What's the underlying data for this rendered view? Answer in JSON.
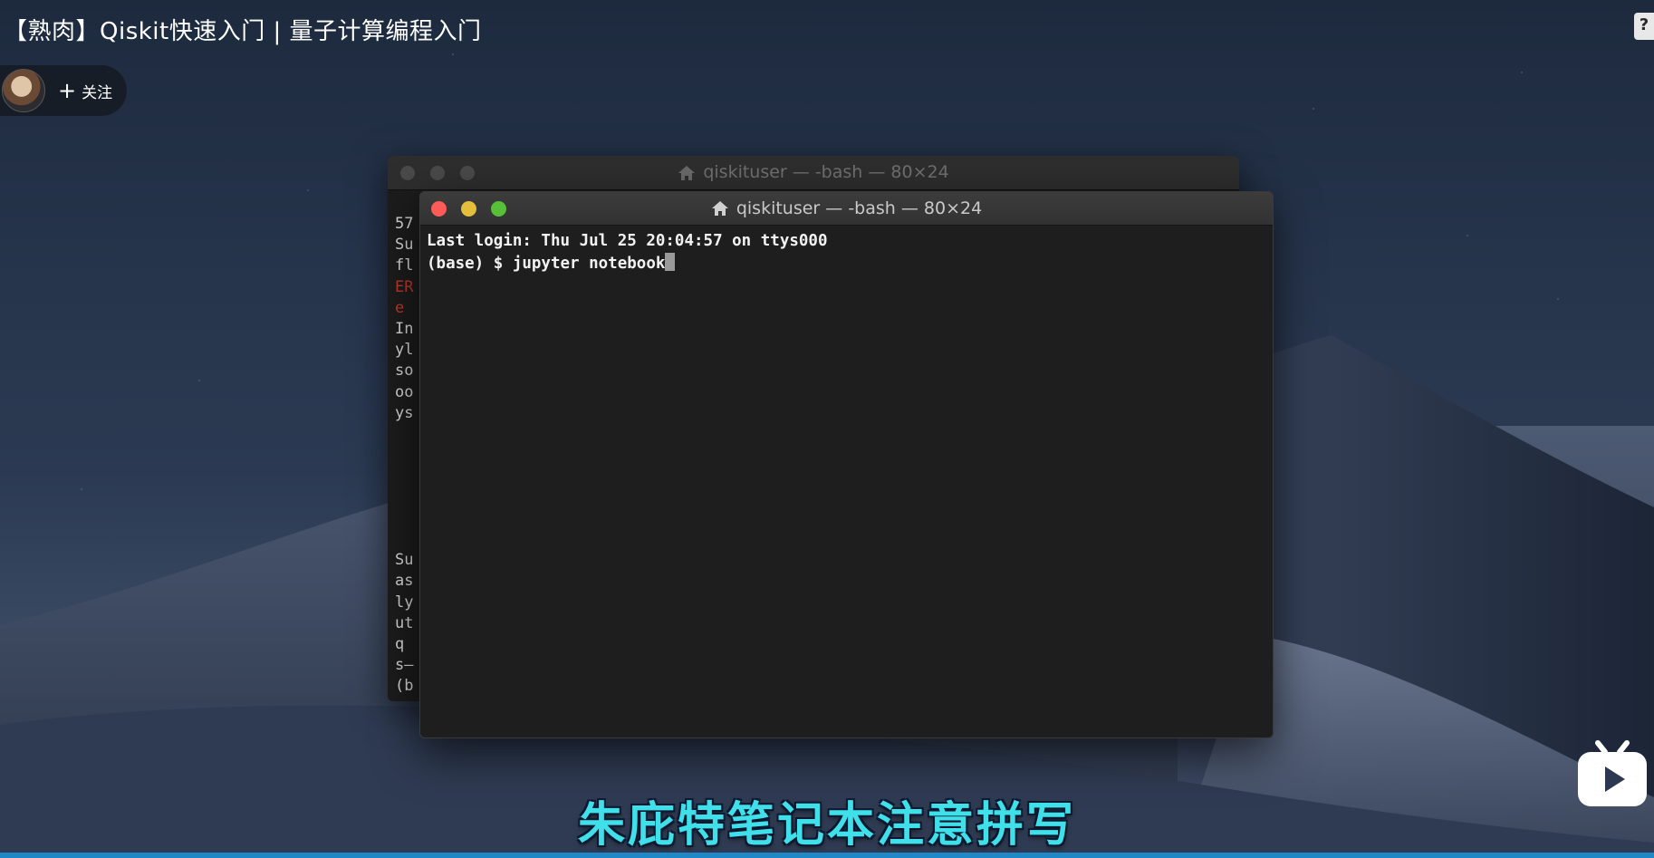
{
  "video": {
    "title": "【熟肉】Qiskit快速入门 | 量子计算编程入门",
    "subtitle": "朱庇特笔记本注意拼写",
    "progress_fraction": 1.0
  },
  "uploader": {
    "follow_label": "关注"
  },
  "terminal_back": {
    "title": "qiskituser — -bash — 80×24",
    "visible_lines": [
      "57",
      "Su",
      "fl",
      "ER",
      "e",
      "In",
      "yl",
      "so",
      "oo",
      "ys",
      "",
      "",
      "",
      "",
      "",
      "",
      "Su",
      "as",
      "ly",
      "ut",
      " q",
      "s—",
      "(b"
    ],
    "error_line_indices": [
      3,
      4
    ]
  },
  "terminal_front": {
    "title": "qiskituser — -bash — 80×24",
    "line1": "Last login: Thu Jul 25 20:04:57 on ttys000",
    "line2": "(base) $ jupyter notebook"
  },
  "colors": {
    "subtitle": "#3fe0ea",
    "close_button": "#fc5b57",
    "minimize_button": "#e5bf3c",
    "maximize_button": "#57c038",
    "progress": "#1e88c9",
    "bilibili_logo": "#ffffff"
  },
  "icons": {
    "feedback": "feedback-icon",
    "home": "home-icon",
    "bilibili": "bilibili-tv-icon",
    "follow": "plus-icon"
  }
}
